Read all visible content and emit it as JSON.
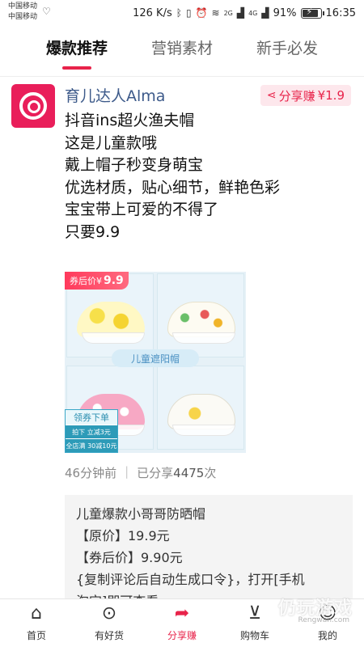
{
  "status_bar": {
    "carrier1": "中国移动",
    "carrier2": "中国移动",
    "speed": "126 K/s",
    "signal1": "2G",
    "signal2": "4G",
    "battery": "91%",
    "time": "16:35",
    "battery_level": 0.91
  },
  "tabs": [
    {
      "label": "爆款推荐",
      "active": true
    },
    {
      "label": "营销素材",
      "active": false
    },
    {
      "label": "新手必发",
      "active": false
    }
  ],
  "post": {
    "author": "育儿达人Alma",
    "share_label": "分享赚",
    "share_amount": "¥1.9",
    "lines": [
      "抖音ins超火渔夫帽",
      "这是儿童款哦",
      "戴上帽子秒变身萌宝",
      "优选材质，贴心细节，鲜艳色彩",
      "宝宝带上可爱的不得了",
      "只要9.9"
    ],
    "image": {
      "promo_prefix": "券后价¥",
      "promo_price": "9.9",
      "center_label": "儿童遮阳帽",
      "coupon_title": "领券下单",
      "coupon_line1": "拍下 立减3元",
      "coupon_line2": "全店满 30减10元"
    },
    "time_ago": "46分钟前",
    "shared_prefix": "已分享",
    "shared_count": "4475",
    "shared_suffix": "次"
  },
  "copy_box": {
    "lines": [
      "儿童爆款小哥哥防晒帽",
      "【原价】19.9元",
      "【券后价】9.90元",
      "{复制评论后自动生成口令}，打开[手机",
      "淘宝]即可查看"
    ]
  },
  "watermark": {
    "text": "仍玩游戏",
    "sub": "Rengwan.com"
  },
  "bottom_nav": [
    {
      "label": "首页",
      "icon": "home-icon",
      "active": false
    },
    {
      "label": "有好货",
      "icon": "location-pin-icon",
      "active": false
    },
    {
      "label": "分享赚",
      "icon": "share-arrow-icon",
      "active": true
    },
    {
      "label": "购物车",
      "icon": "cart-icon",
      "active": false
    },
    {
      "label": "我的",
      "icon": "user-icon",
      "active": false
    }
  ],
  "colors": {
    "accent": "#e8234a",
    "author": "#3d5a8a",
    "avatar_bg": "#e91e5a"
  }
}
